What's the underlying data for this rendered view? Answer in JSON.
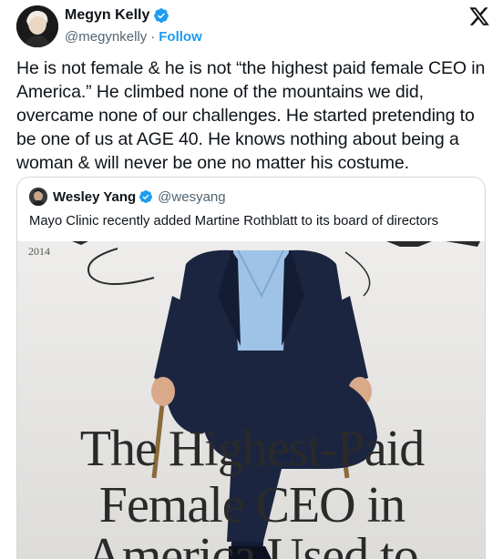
{
  "tweet": {
    "author_name": "Megyn Kelly",
    "author_handle": "@megynkelly",
    "separator": "·",
    "follow_label": "Follow",
    "text": "He is not female & he is not “the highest paid female CEO in America.” He climbed none of the mountains we did, overcame none of our challenges. He started pretending to be one of us at AGE 40. He knows nothing about being a woman & will never be one no matter his costume."
  },
  "quoted_tweet": {
    "author_name": "Wesley Yang",
    "author_handle": "@wesyang",
    "text": "Mayo Clinic recently added Martine Rothblatt to its board of directors",
    "image": {
      "year_label": "2014",
      "headline_line1": "The Highest-Paid",
      "headline_line2": "Female CEO in",
      "headline_line3": "America Used to"
    }
  },
  "icons": {
    "verified": "verified-badge-icon",
    "x_logo": "x-logo-icon"
  },
  "colors": {
    "verified_blue": "#1d9bf0",
    "follow_blue": "#1d9bf0",
    "secondary_text": "#536471",
    "suit_navy": "#1b2540",
    "shirt_blue": "#9ec3e6"
  }
}
